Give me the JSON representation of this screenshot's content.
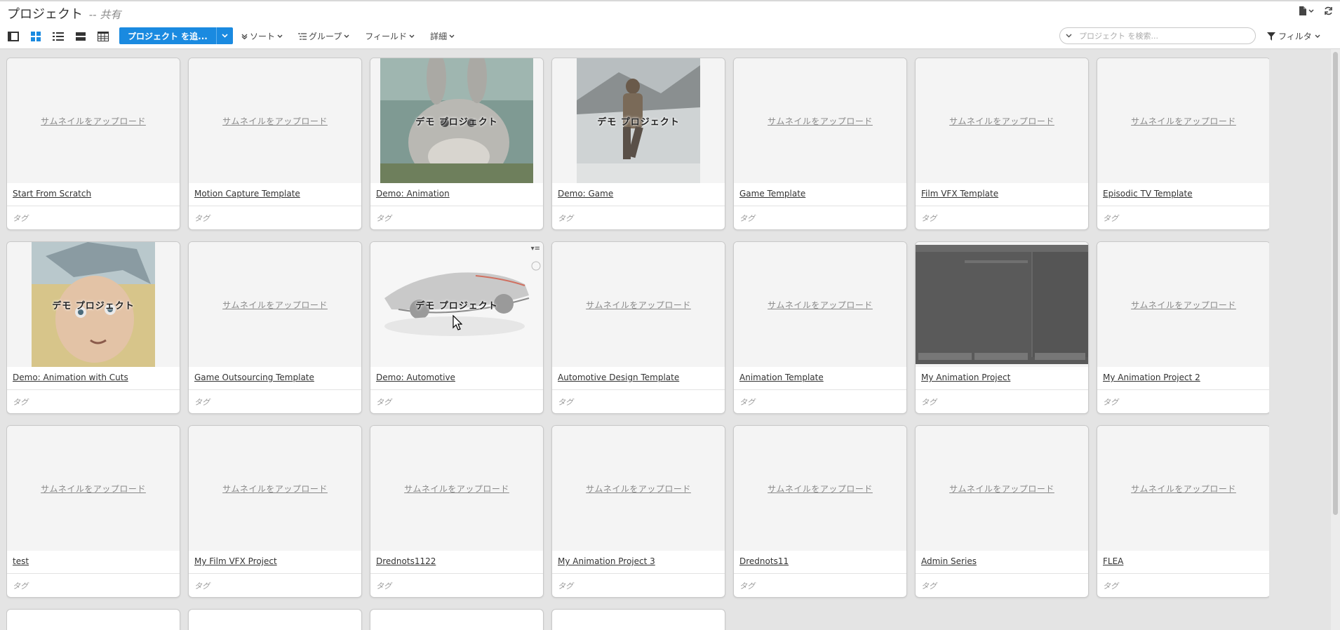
{
  "header": {
    "title": "プロジェクト",
    "separator": " -- ",
    "subtitle": "共有"
  },
  "toolbar": {
    "add_project_label": "プロジェクト を追...",
    "menus": [
      {
        "label": "ソート"
      },
      {
        "label": "グループ"
      },
      {
        "label": "フィールド"
      },
      {
        "label": "詳細"
      }
    ],
    "search_placeholder": "プロジェクト を検索...",
    "filter_label": "フィルタ"
  },
  "card_text": {
    "upload": "サムネイルをアップロード",
    "demo": "デモ プロジェクト",
    "tag": "タグ"
  },
  "projects": [
    {
      "name": "Start From Scratch",
      "thumb": "upload"
    },
    {
      "name": "Motion Capture Template",
      "thumb": "upload"
    },
    {
      "name": "Demo: Animation",
      "thumb": "demo-bunny"
    },
    {
      "name": "Demo: Game",
      "thumb": "demo-game"
    },
    {
      "name": "Game Template",
      "thumb": "upload"
    },
    {
      "name": "Film VFX Template",
      "thumb": "upload"
    },
    {
      "name": "Episodic TV Template",
      "thumb": "upload"
    },
    {
      "name": "Demo: Animation with Cuts",
      "thumb": "demo-cuts"
    },
    {
      "name": "Game Outsourcing Template",
      "thumb": "upload"
    },
    {
      "name": "Demo: Automotive",
      "thumb": "demo-car"
    },
    {
      "name": "Automotive Design Template",
      "thumb": "upload"
    },
    {
      "name": "Animation Template",
      "thumb": "upload"
    },
    {
      "name": "My Animation Project",
      "thumb": "screenshot"
    },
    {
      "name": "My Animation Project 2",
      "thumb": "upload"
    },
    {
      "name": "test",
      "thumb": "upload"
    },
    {
      "name": "My Film VFX Project",
      "thumb": "upload"
    },
    {
      "name": "Drednots1122",
      "thumb": "upload"
    },
    {
      "name": "My Animation Project 3",
      "thumb": "upload"
    },
    {
      "name": "Drednots11",
      "thumb": "upload"
    },
    {
      "name": "Admin Series",
      "thumb": "upload"
    },
    {
      "name": "FLEA",
      "thumb": "upload"
    }
  ],
  "colors": {
    "accent": "#1a8ae0",
    "background": "#e4e4e4"
  }
}
